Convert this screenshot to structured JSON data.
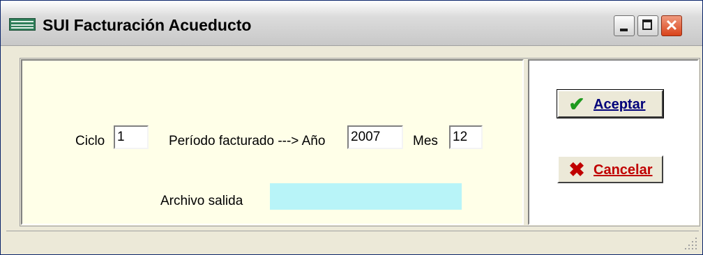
{
  "window": {
    "title": "SUI Facturación Acueducto"
  },
  "form": {
    "ciclo_label": "Ciclo",
    "ciclo_value": "1",
    "periodo_label": "Período facturado ---> Año",
    "anio_value": "2007",
    "mes_label": "Mes",
    "mes_value": "12",
    "archivo_label": "Archivo salida",
    "archivo_value": ""
  },
  "actions": {
    "accept_label": "Aceptar",
    "cancel_label": "Cancelar",
    "accept_icon": "checkmark-icon",
    "cancel_icon": "x-mark-icon"
  },
  "colors": {
    "panel_background": "#ffffe8",
    "output_field": "#b8f4f8",
    "accept_icon": "#1e9a1e",
    "cancel": "#c00000"
  }
}
